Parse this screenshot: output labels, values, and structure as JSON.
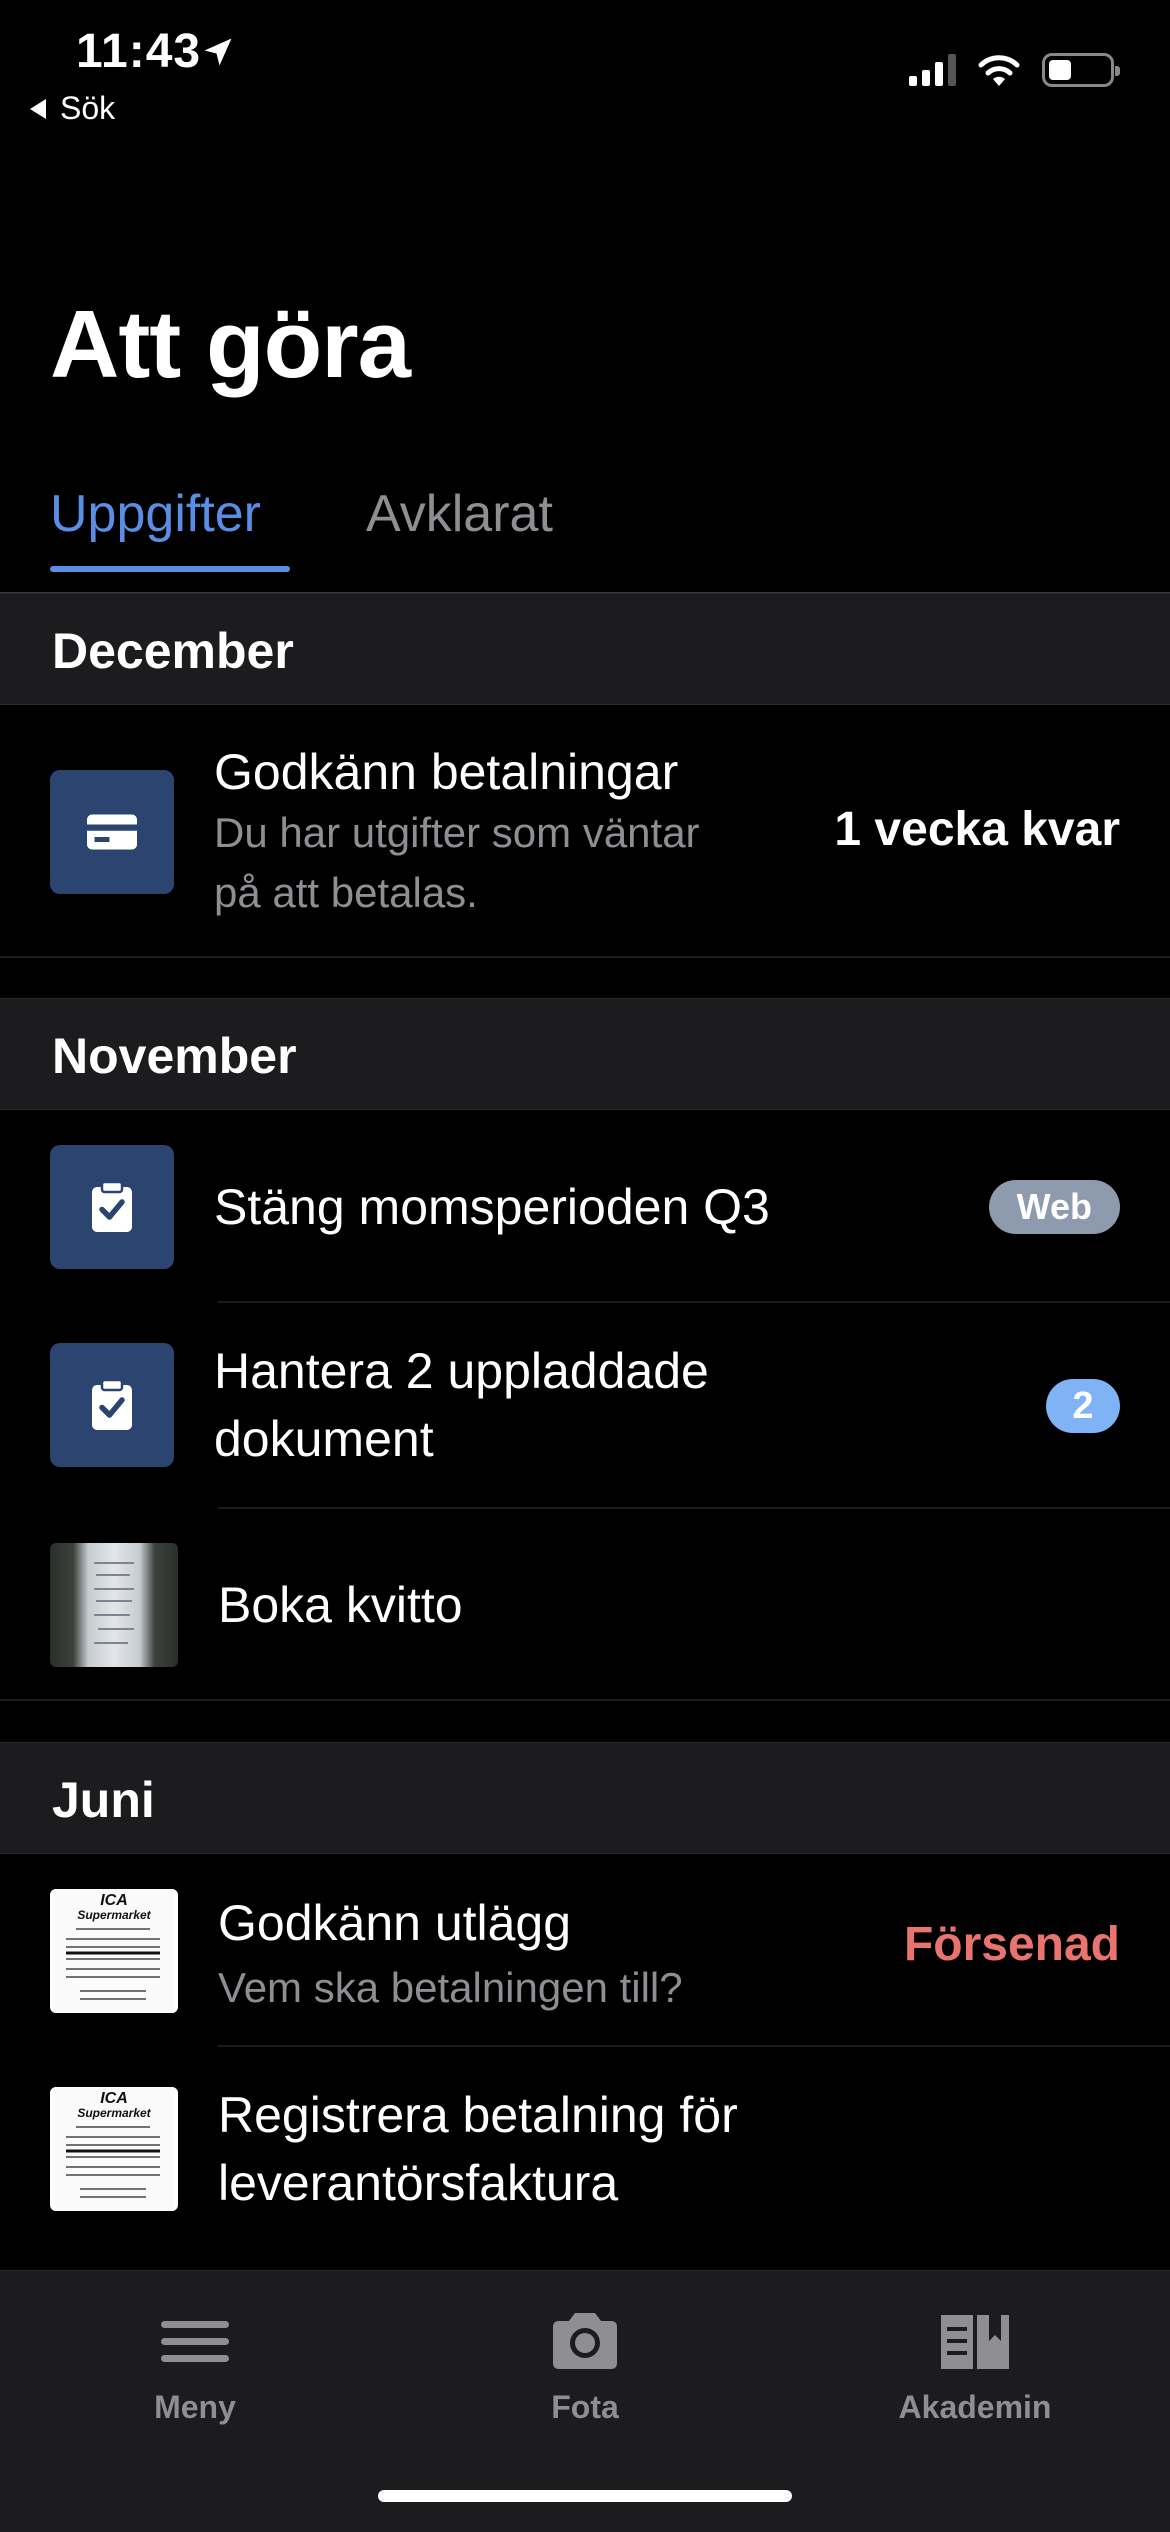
{
  "status_bar": {
    "time": "11:43",
    "back_label": "Sök"
  },
  "page": {
    "title": "Att göra"
  },
  "tabs": [
    {
      "label": "Uppgifter"
    },
    {
      "label": "Avklarat"
    }
  ],
  "sections": [
    {
      "header": "December",
      "rows": [
        {
          "title": "Godkänn betalningar",
          "subtitle_line1": "Du har utgifter som väntar",
          "subtitle_line2": "på att betalas.",
          "right": "1 vecka kvar",
          "icon": "card-icon"
        }
      ]
    },
    {
      "header": "November",
      "rows": [
        {
          "title": "Stäng momsperioden Q3",
          "badge": "Web",
          "icon": "clipboard-check-icon"
        },
        {
          "title_line1": "Hantera 2 uppladdade",
          "title_line2": "dokument",
          "badge": "2",
          "icon": "clipboard-check-icon"
        },
        {
          "title": "Boka kvitto",
          "icon": "receipt-thumbnail"
        }
      ]
    },
    {
      "header": "Juni",
      "rows": [
        {
          "title": "Godkänn utlägg",
          "subtitle": "Vem ska betalningen till?",
          "right": "Försenad",
          "icon": "receipt-thumbnail"
        },
        {
          "title_line1": "Registrera betalning för",
          "title_line2": "leverantörsfaktura",
          "icon": "receipt-thumbnail"
        }
      ]
    }
  ],
  "receipt": {
    "brand_line1": "ICA",
    "brand_line2": "Supermarket"
  },
  "tab_bar": [
    {
      "label": "Meny",
      "icon": "menu-icon"
    },
    {
      "label": "Fota",
      "icon": "camera-icon"
    },
    {
      "label": "Akademin",
      "icon": "book-icon"
    }
  ],
  "colors": {
    "accent": "#5a8ee6",
    "late": "#e8736f",
    "icon_bg": "#2b4470",
    "section_bg": "#1c1c1e"
  }
}
